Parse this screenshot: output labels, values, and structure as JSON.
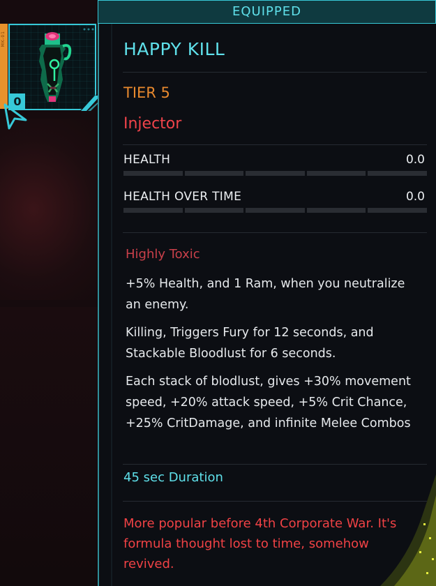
{
  "header": {
    "status_label": "EQUIPPED"
  },
  "item": {
    "name": "HAPPY KILL",
    "tier": "TIER 5",
    "type": "Injector",
    "quantity": "0",
    "slot_strip_text": "MK-01"
  },
  "stats": [
    {
      "label": "HEALTH",
      "value": "0.0",
      "fraction": 0.0
    },
    {
      "label": "HEALTH OVER TIME",
      "value": "0.0",
      "fraction": 0.0
    }
  ],
  "effect": {
    "name": "Highly Toxic",
    "paragraphs": [
      "+5% Health, and 1 Ram, when you neutralize an enemy.",
      "Killing, Triggers Fury for 12 seconds, and Stackable Bloodlust for 6 seconds.",
      "Each stack of blodlust, gives +30% movement speed, +20% attack speed, +5% Crit Chance, +25% CritDamage, and infinite Melee Combos"
    ]
  },
  "duration": "45 sec  Duration",
  "flavor_text": "More popular before 4th Corporate War. It's formula thought lost to time, somehow revived.",
  "colors": {
    "accent_cyan": "#5fe0ea",
    "tier_orange": "#e8892e",
    "type_red": "#f0434a",
    "effect_red": "#c9404a",
    "panel_bg": "#0c0e13"
  },
  "icons": [
    "injector-icon",
    "selection-pointer-icon"
  ]
}
